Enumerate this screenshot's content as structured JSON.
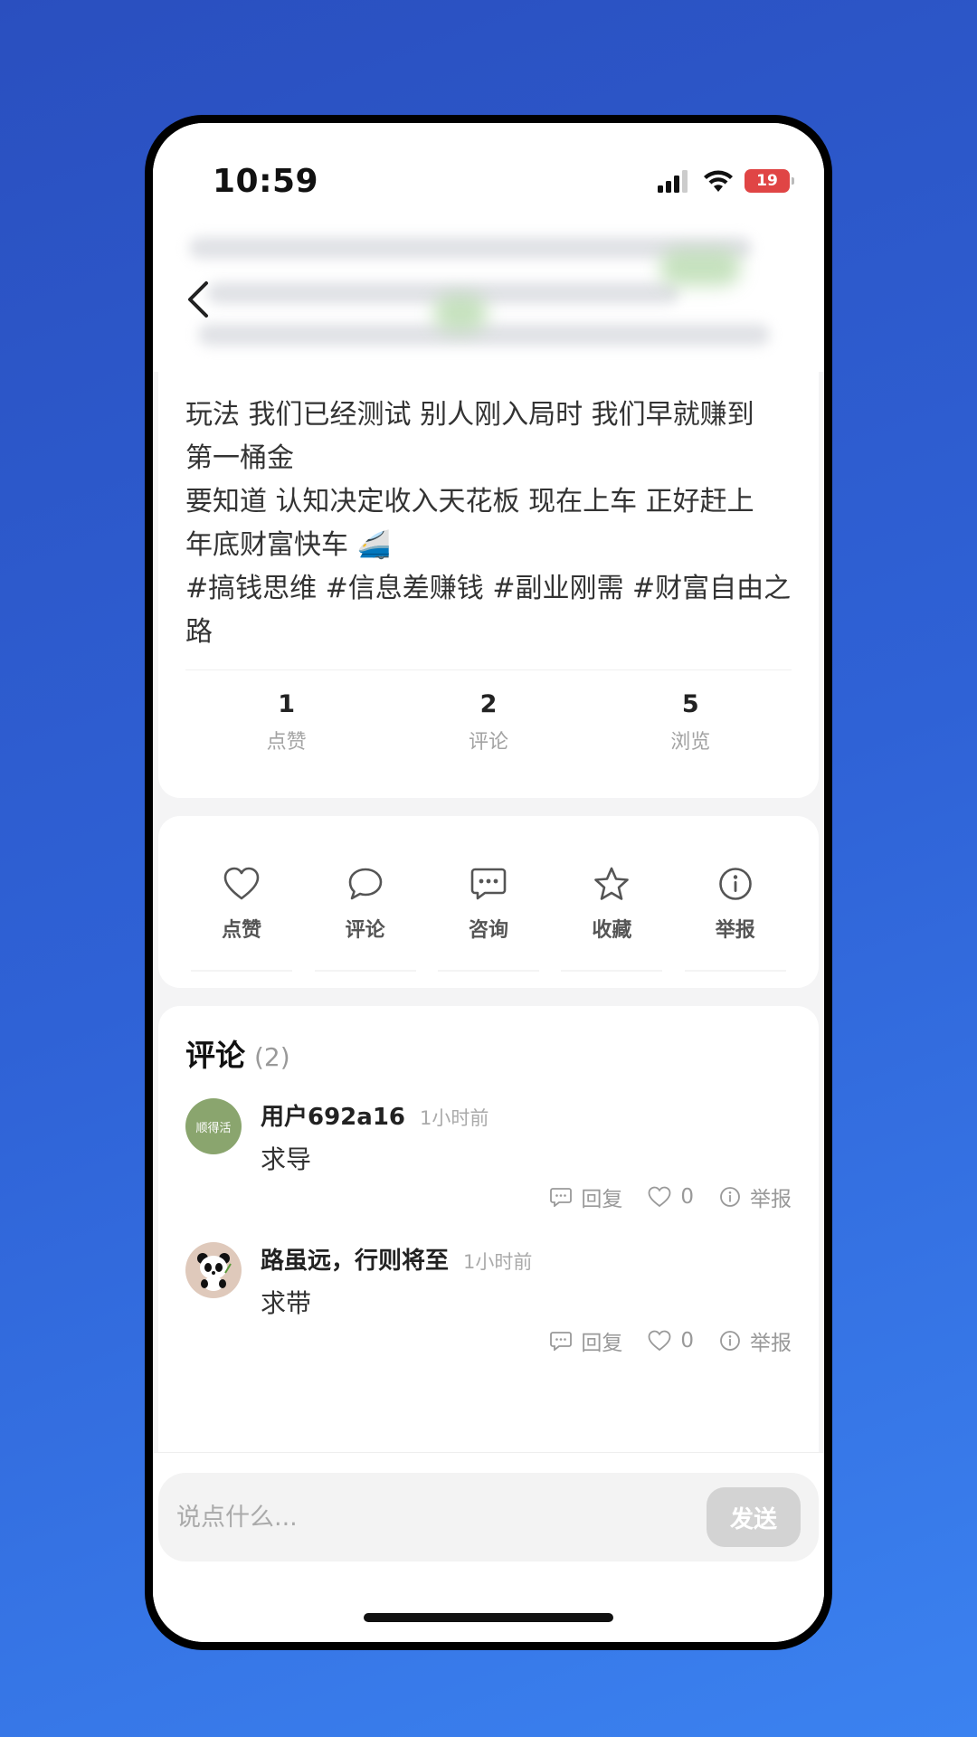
{
  "status_bar": {
    "time": "10:59",
    "battery": "19"
  },
  "post": {
    "lines": [
      "玩法 我们已经测试 别人刚入局时 我们早就赚到",
      "第一桶金",
      "要知道 认知决定收入天花板 现在上车 正好赶上",
      "年底财富快车 🚄",
      "#搞钱思维 #信息差赚钱 #副业刚需 #财富自由之",
      "路"
    ]
  },
  "stats": [
    {
      "value": "1",
      "label": "点赞"
    },
    {
      "value": "2",
      "label": "评论"
    },
    {
      "value": "5",
      "label": "浏览"
    }
  ],
  "actions": [
    {
      "label": "点赞",
      "icon": "heart-icon"
    },
    {
      "label": "评论",
      "icon": "comment-bubble-icon"
    },
    {
      "label": "咨询",
      "icon": "chat-dots-icon"
    },
    {
      "label": "收藏",
      "icon": "star-icon"
    },
    {
      "label": "举报",
      "icon": "info-icon"
    }
  ],
  "comments_section": {
    "title": "评论",
    "count": "(2)",
    "items": [
      {
        "avatar_text": "顺得活",
        "name": "用户692a16",
        "time": "1小时前",
        "body": "求导",
        "reply": "回复",
        "likes": "0",
        "report": "举报"
      },
      {
        "avatar_icon": "panda-avatar",
        "name": "路虽远，行则将至",
        "time": "1小时前",
        "body": "求带",
        "reply": "回复",
        "likes": "0",
        "report": "举报"
      }
    ]
  },
  "input": {
    "placeholder": "说点什么...",
    "send_label": "发送"
  },
  "colors": {
    "background_start": "#2a4fbf",
    "background_end": "#3b82f0",
    "battery_low": "#e04545"
  }
}
